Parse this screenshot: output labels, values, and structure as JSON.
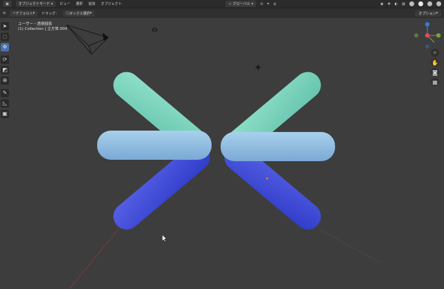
{
  "header": {
    "mode": "オブジェクトモード",
    "menus": [
      "ビュー",
      "選択",
      "追加",
      "オブジェクト"
    ],
    "transform": "グローバル"
  },
  "subheader": {
    "orientation": "デフォルト",
    "drag": "ドラッグ：",
    "select_mode": "ボックス選択",
    "options": "オプション"
  },
  "viewport": {
    "title": "ユーザー・透視投影",
    "collection": "(1) Collection | 立方体.004"
  },
  "gizmo": {
    "axes": {
      "x": "X",
      "y": "Y",
      "z": "Z"
    },
    "colors": {
      "x": "#e04c5c",
      "y": "#74a43a",
      "z": "#3d78d8"
    }
  },
  "colors": {
    "accent": "#4772b3",
    "teal": "#7dd6bd",
    "light_blue": "#93bfe0",
    "deep_blue": "#4052d8"
  },
  "icons": {
    "tools": [
      "cursor-select-icon",
      "lasso-icon",
      "move-icon",
      "rotate-icon",
      "scale-icon",
      "transform-icon",
      "annotate-icon",
      "measure-icon",
      "add-cube-icon"
    ]
  }
}
